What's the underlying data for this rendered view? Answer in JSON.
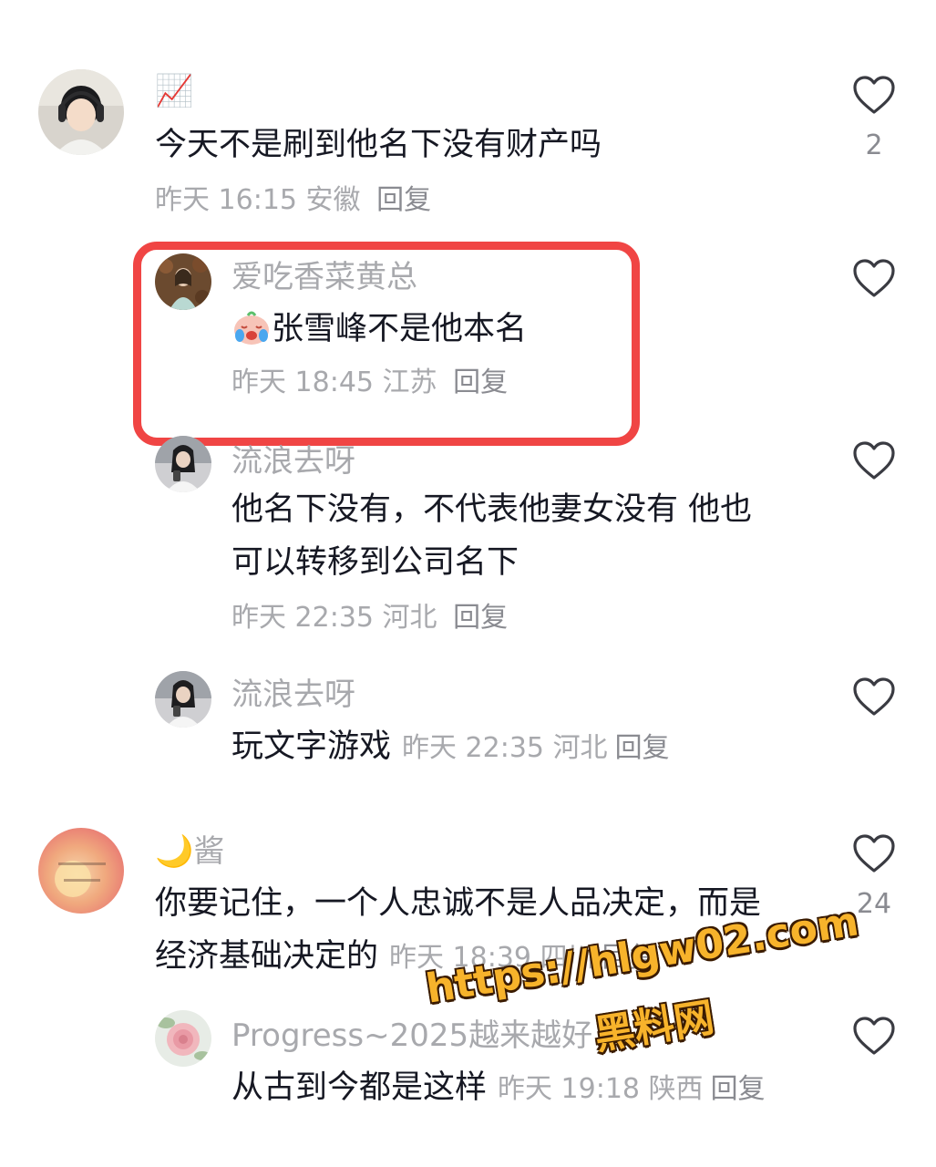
{
  "comments": [
    {
      "username": "📈",
      "text": "今天不是刷到他名下没有财产吗",
      "time": "昨天 16:15",
      "location": "安徽",
      "reply_label": "回复",
      "likes": "2",
      "replies": [
        {
          "username": "爱吃香菜黄总",
          "text": "张雪峰不是他本名",
          "emoji": "crying-face",
          "time": "昨天 18:45",
          "location": "江苏",
          "reply_label": "回复"
        },
        {
          "username": "流浪去呀",
          "text_lines": [
            "他名下没有，不代表他妻女没有 他也",
            "可以转移到公司名下"
          ],
          "time": "昨天 22:35",
          "location": "河北",
          "reply_label": "回复"
        },
        {
          "username": "流浪去呀",
          "text": "玩文字游戏",
          "time": "昨天 22:35",
          "location": "河北",
          "reply_label": "回复"
        }
      ]
    },
    {
      "username": "🌙酱",
      "text_lines": [
        "你要记住，一个人忠诚不是人品决定，而是",
        "经济基础决定的"
      ],
      "time": "昨天 18:39",
      "location": "四川",
      "reply_label": "回复",
      "likes": "24",
      "replies": [
        {
          "username": "Progress~2025越来越好",
          "text": "从古到今都是这样",
          "time": "昨天 19:18",
          "location": "陕西",
          "reply_label": "回复"
        }
      ]
    }
  ],
  "watermark": {
    "url": "https://hlgw02.com",
    "name": "黑料网"
  },
  "colors": {
    "highlight_border": "#f04544",
    "meta_text": "#a8a9ad",
    "main_text": "#161823",
    "watermark_fill": "#f7b32b"
  }
}
